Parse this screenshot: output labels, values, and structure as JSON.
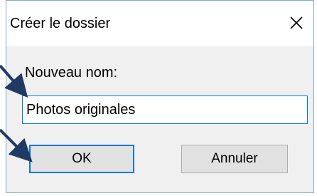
{
  "window": {
    "title": "Créer le dossier",
    "close_icon": "close-icon"
  },
  "form": {
    "label": "Nouveau nom:",
    "name_value": "Photos originales"
  },
  "buttons": {
    "ok_label": "OK",
    "cancel_label": "Annuler"
  },
  "colors": {
    "accent": "#0078d7",
    "annotation_arrow": "#1f3b63"
  }
}
